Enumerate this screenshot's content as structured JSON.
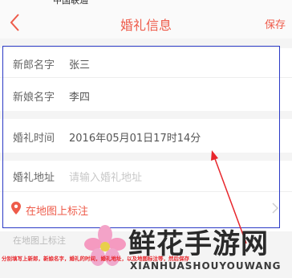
{
  "status_bar": {
    "text": "中国联通"
  },
  "navbar": {
    "title": "婚礼信息",
    "save_label": "保存"
  },
  "form": {
    "groom": {
      "label": "新郎名字",
      "value": "张三"
    },
    "bride": {
      "label": "新娘名字",
      "value": "李四"
    },
    "time": {
      "label": "婚礼时间",
      "value": "2016年05月01日17时14分"
    },
    "address": {
      "label": "婚礼地址",
      "placeholder": "请输入婚礼地址"
    },
    "map": {
      "label": "在地图上标注"
    }
  },
  "hint": "在地图上标注",
  "annotation": "分别填写上新郎，新娘名字，婚礼的时间，婚礼地址，以及地图标注等，然后保存",
  "watermark": {
    "cn": "鲜花手游网",
    "en": "XIANHUASHOUYOUWANG"
  },
  "colors": {
    "accent": "#ee5b4a",
    "frame": "#2b3ac6",
    "annotation": "#e8262c"
  }
}
